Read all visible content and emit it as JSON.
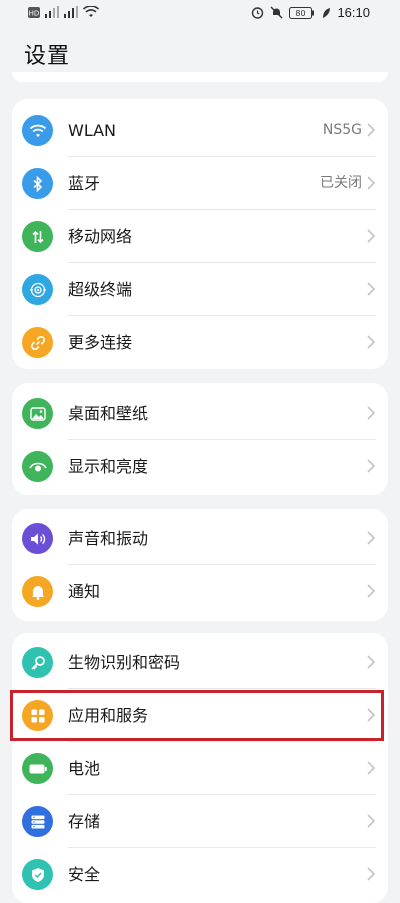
{
  "status_bar": {
    "time": "16:10",
    "battery": "80"
  },
  "page": {
    "title": "设置"
  },
  "groups": [
    {
      "items": [
        {
          "label": "WLAN",
          "value": "NS5G",
          "icon": "wifi-icon",
          "color": "#3a9be8"
        },
        {
          "label": "蓝牙",
          "value": "已关闭",
          "icon": "bluetooth-icon",
          "color": "#3a9be8"
        },
        {
          "label": "移动网络",
          "value": "",
          "icon": "mobile-network-icon",
          "color": "#3fb45a"
        },
        {
          "label": "超级终端",
          "value": "",
          "icon": "super-device-icon",
          "color": "#2fa7e0"
        },
        {
          "label": "更多连接",
          "value": "",
          "icon": "link-icon",
          "color": "#f5a623"
        }
      ]
    },
    {
      "items": [
        {
          "label": "桌面和壁纸",
          "value": "",
          "icon": "wallpaper-icon",
          "color": "#3fb45a"
        },
        {
          "label": "显示和亮度",
          "value": "",
          "icon": "display-eye-icon",
          "color": "#3fb45a"
        }
      ]
    },
    {
      "items": [
        {
          "label": "声音和振动",
          "value": "",
          "icon": "speaker-icon",
          "color": "#6b4fd6"
        },
        {
          "label": "通知",
          "value": "",
          "icon": "bell-icon",
          "color": "#f5a623"
        }
      ]
    },
    {
      "items": [
        {
          "label": "生物识别和密码",
          "value": "",
          "icon": "key-icon",
          "color": "#2fc2b0"
        },
        {
          "label": "应用和服务",
          "value": "",
          "icon": "apps-icon",
          "color": "#f5a623"
        },
        {
          "label": "电池",
          "value": "",
          "icon": "battery-icon",
          "color": "#3fb45a"
        },
        {
          "label": "存储",
          "value": "",
          "icon": "storage-icon",
          "color": "#2f6fe0"
        },
        {
          "label": "安全",
          "value": "",
          "icon": "shield-icon",
          "color": "#2fc2b0"
        }
      ]
    }
  ],
  "highlight": {
    "color": "#c8232b"
  }
}
